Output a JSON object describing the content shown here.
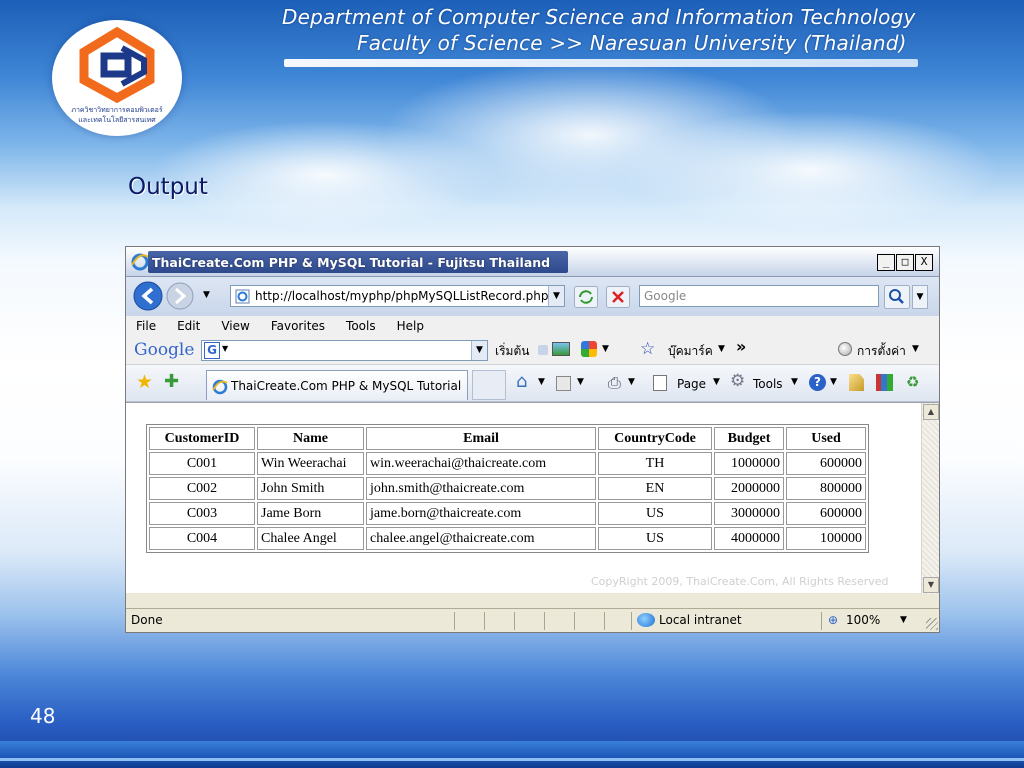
{
  "slide": {
    "logo_text_1": "ภาควิชาวิทยาการคอมพิวเตอร์",
    "logo_text_2": "และเทคโนโลยีสารสนเทศ",
    "header_line1": "Department of Computer Science and Information Technology",
    "header_line2": "Faculty of Science >> Naresuan University (Thailand)",
    "output_label": "Output",
    "page_number": "48"
  },
  "browser": {
    "title": "ThaiCreate.Com PHP & MySQL Tutorial - Fujitsu Thailand",
    "window_buttons": [
      "_",
      "□",
      "X"
    ],
    "url": "http://localhost/myphp/phpMySQLListRecord.php",
    "search_placeholder": "Google",
    "menu": [
      "File",
      "Edit",
      "View",
      "Favorites",
      "Tools",
      "Help"
    ],
    "google_toolbar": {
      "logo": "Google",
      "start_label": "เริ่มต้น",
      "bookmarks_label": "บุ๊คมาร์ค",
      "more_label": "»",
      "settings_label": "การตั้งค่า"
    },
    "tab_title": "ThaiCreate.Com PHP & MySQL Tutorial",
    "commands": {
      "page": "Page",
      "tools": "Tools"
    },
    "table": {
      "headers": [
        "CustomerID",
        "Name",
        "Email",
        "CountryCode",
        "Budget",
        "Used"
      ],
      "rows": [
        [
          "C001",
          "Win Weerachai",
          "win.weerachai@thaicreate.com",
          "TH",
          "1000000",
          "600000"
        ],
        [
          "C002",
          "John Smith",
          "john.smith@thaicreate.com",
          "EN",
          "2000000",
          "800000"
        ],
        [
          "C003",
          "Jame Born",
          "jame.born@thaicreate.com",
          "US",
          "3000000",
          "600000"
        ],
        [
          "C004",
          "Chalee Angel",
          "chalee.angel@thaicreate.com",
          "US",
          "4000000",
          "100000"
        ]
      ]
    },
    "watermark_copyright": "CopyRight 2009, ThaiCreate.Com, All Rights Reserved",
    "status": {
      "text": "Done",
      "zone": "Local intranet",
      "zoom": "100%"
    }
  },
  "colors": {
    "output_label": "#0a1a66",
    "header_text": "#ffffff",
    "slide_top": "#1c5fb8"
  }
}
